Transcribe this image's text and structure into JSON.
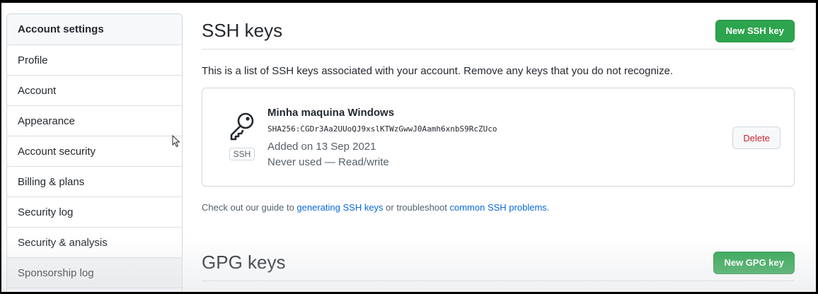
{
  "sidebar": {
    "header": "Account settings",
    "items": [
      {
        "label": "Profile"
      },
      {
        "label": "Account"
      },
      {
        "label": "Appearance"
      },
      {
        "label": "Account security"
      },
      {
        "label": "Billing & plans"
      },
      {
        "label": "Security log"
      },
      {
        "label": "Security & analysis"
      },
      {
        "label": "Sponsorship log"
      }
    ]
  },
  "ssh": {
    "title": "SSH keys",
    "new_button": "New SSH key",
    "intro": "This is a list of SSH keys associated with your account. Remove any keys that you do not recognize.",
    "key": {
      "name": "Minha maquina Windows",
      "fingerprint": "SHA256:CGDr3Aa2UUoQJ9xslKTWzGwwJ0Aamh6xnbS9RcZUco",
      "added": "Added on 13 Sep 2021",
      "usage": "Never used — Read/write",
      "badge": "SSH",
      "icon": "key-icon",
      "delete_button": "Delete"
    },
    "guide": {
      "prefix": "Check out our guide to ",
      "link1": "generating SSH keys",
      "middle": " or troubleshoot ",
      "link2": "common SSH problems",
      "suffix": "."
    }
  },
  "gpg": {
    "title": "GPG keys",
    "new_button": "New GPG key"
  },
  "colors": {
    "primary_button": "#2da44e",
    "danger_text": "#cf222e",
    "link": "#0969da"
  }
}
